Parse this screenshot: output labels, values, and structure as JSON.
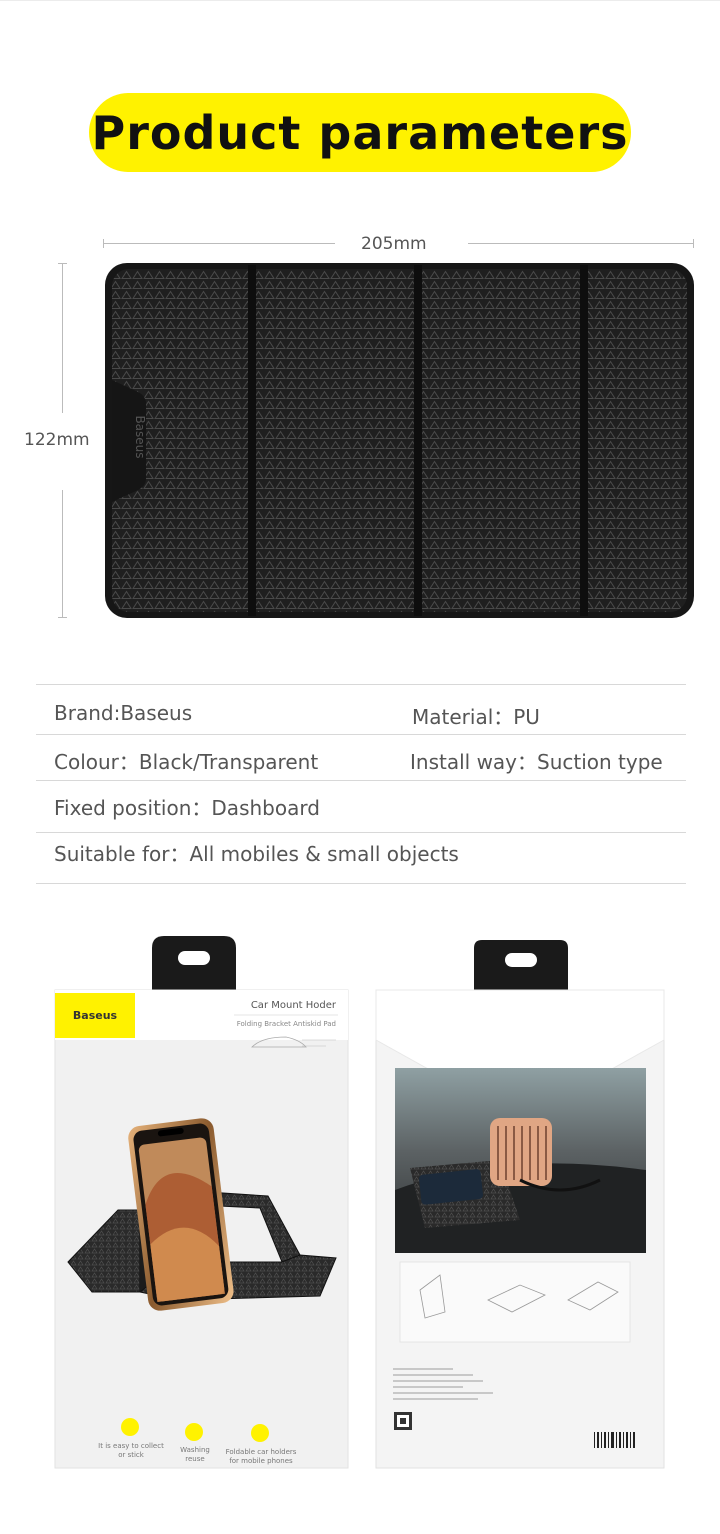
{
  "header": {
    "title": "Product parameters"
  },
  "dimensions": {
    "width_label": "205mm",
    "height_label": "122mm"
  },
  "pad": {
    "logo_text": "Baseus",
    "color": "#1e1e1e"
  },
  "parameters": [
    {
      "label": "Brand:",
      "value": "Baseus"
    },
    {
      "label": "Material：",
      "value": "PU"
    },
    {
      "label": "Colour：",
      "value": "Black/Transparent"
    },
    {
      "label": "Install way：",
      "value": "Suction type"
    },
    {
      "label": "Fixed position：",
      "value": "Dashboard"
    },
    {
      "label": "Suitable for：",
      "value": "All mobiles & small objects"
    }
  ],
  "package_front": {
    "brand": "Baseus",
    "title": "Car Mount Hoder",
    "subtitle": "Folding Bracket Antiskid Pad",
    "features": [
      {
        "line1": "It is easy to collect",
        "line2": "or stick"
      },
      {
        "line1": "Washing",
        "line2": "reuse"
      },
      {
        "line1": "Foldable car holders",
        "line2": "for mobile phones"
      }
    ]
  },
  "accent_color": "#fff200"
}
